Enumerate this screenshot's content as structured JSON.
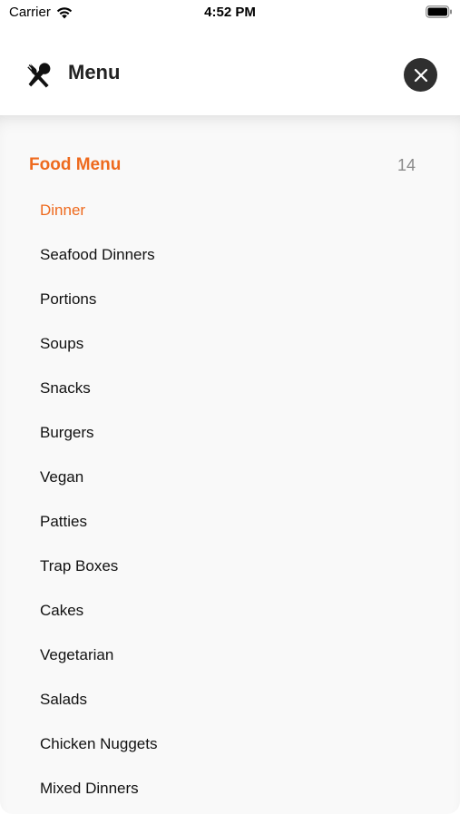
{
  "status_bar": {
    "carrier": "Carrier",
    "time": "4:52 PM"
  },
  "header": {
    "icon": "fork-spoon-icon",
    "title": "Menu",
    "close_icon": "close-icon"
  },
  "section": {
    "title": "Food Menu",
    "count": "14"
  },
  "items": [
    {
      "label": "Dinner",
      "active": true
    },
    {
      "label": "Seafood Dinners",
      "active": false
    },
    {
      "label": "Portions",
      "active": false
    },
    {
      "label": "Soups",
      "active": false
    },
    {
      "label": "Snacks",
      "active": false
    },
    {
      "label": "Burgers",
      "active": false
    },
    {
      "label": "Vegan",
      "active": false
    },
    {
      "label": "Patties",
      "active": false
    },
    {
      "label": "Trap Boxes",
      "active": false
    },
    {
      "label": "Cakes",
      "active": false
    },
    {
      "label": "Vegetarian",
      "active": false
    },
    {
      "label": "Salads",
      "active": false
    },
    {
      "label": "Chicken Nuggets",
      "active": false
    },
    {
      "label": "Mixed Dinners",
      "active": false
    }
  ],
  "colors": {
    "accent": "#ee6a1e",
    "close_button": "#2f2f2f",
    "panel_background": "#f9f9f9"
  }
}
